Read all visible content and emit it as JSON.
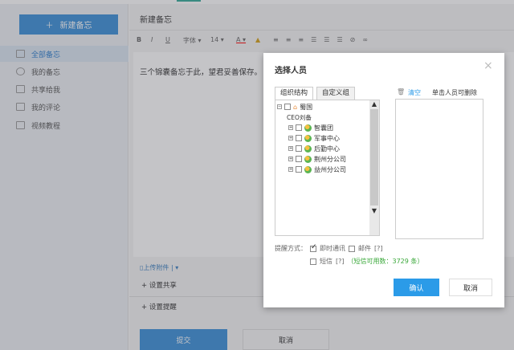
{
  "sidebar": {
    "new_button": "新建备忘",
    "items": [
      {
        "label": "全部备忘",
        "active": true
      },
      {
        "label": "我的备忘"
      },
      {
        "label": "共享给我"
      },
      {
        "label": "我的评论"
      },
      {
        "label": "视频教程"
      }
    ]
  },
  "main": {
    "title": "新建备忘",
    "toolbar": {
      "bold": "B",
      "italic": "I",
      "underline": "U",
      "font": "字体",
      "size": "14",
      "color": "A"
    },
    "editor_text": "三个锦囊备忘于此，望君妥善保存。",
    "upload": "上传附件",
    "set_share": "设置共享",
    "set_reminder": "设置提醒",
    "submit": "提交",
    "cancel": "取消"
  },
  "modal": {
    "title": "选择人员",
    "close": "×",
    "tabs": [
      "组织结构",
      "自定义组"
    ],
    "tree": {
      "root": "蜀国",
      "ceo": "CEO刘备",
      "children": [
        "智囊团",
        "军事中心",
        "后勤中心",
        "荆州分公司",
        "益州分公司"
      ]
    },
    "clear": "清空",
    "hint": "单击人员可删除",
    "reminder_label": "提醒方式：",
    "im": "即时通讯",
    "im_checked": true,
    "email": "邮件",
    "help": "[?]",
    "sms": "短信",
    "sms_quota": "（短信可用数：3729 条）",
    "confirm": "确认",
    "cancel": "取消"
  },
  "colors": {
    "primary": "#2b9be8",
    "sidebar_btn": "#3a8fd9",
    "green": "#3aa83a"
  }
}
